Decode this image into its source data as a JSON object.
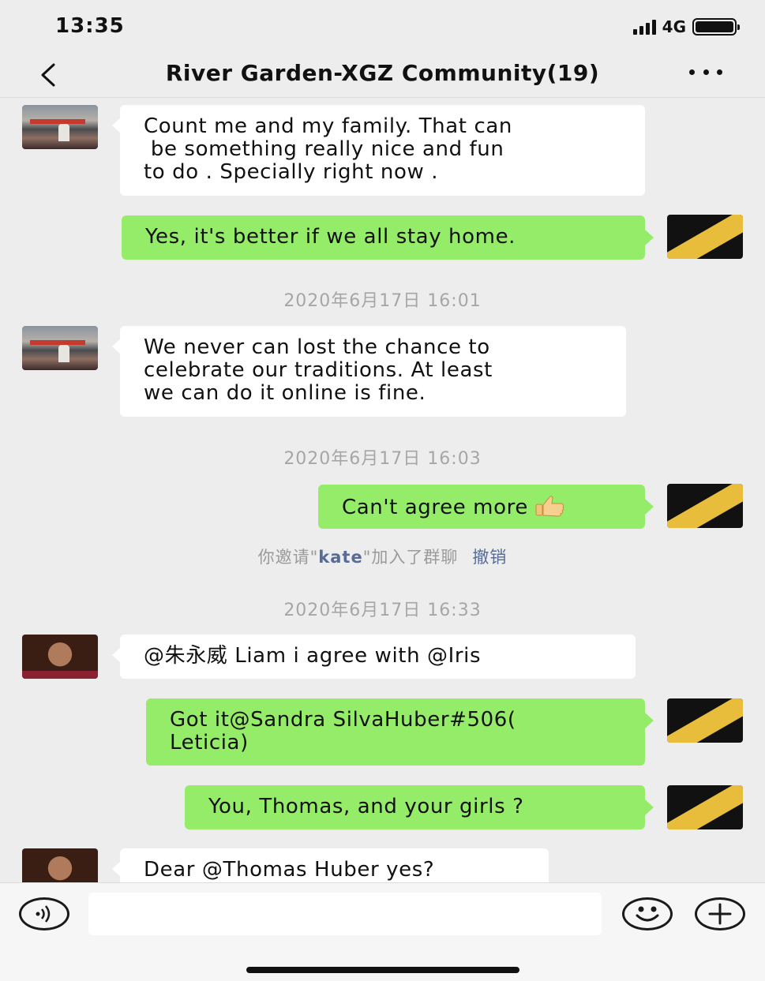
{
  "status_bar": {
    "time": "13:35",
    "network": "4G"
  },
  "nav": {
    "title": "River Garden-XGZ Community(19)",
    "back_icon": "chevron-left-icon",
    "more_icon": "more-dots-icon"
  },
  "messages": [
    {
      "side": "in",
      "avatar": "boat-photo-avatar",
      "text": [
        "Count me and my family. That can",
        " be something really nice and fun",
        "to do . Specially right now ."
      ]
    },
    {
      "side": "out",
      "avatar": "black-yellow-avatar",
      "text": [
        "Yes, it's better if we all stay home."
      ]
    },
    {
      "side": "in",
      "avatar": "boat-photo-avatar",
      "text": [
        "We never can lost the chance to",
        "celebrate our traditions. At least",
        "we can do it online is fine."
      ]
    },
    {
      "side": "out",
      "avatar": "black-yellow-avatar",
      "text": [
        "Can't agree more"
      ],
      "emoji": "thumbs-up-icon"
    },
    {
      "side": "in",
      "avatar": "woman-photo-avatar",
      "text": [
        "@朱永威 Liam  i agree  with @Iris"
      ]
    },
    {
      "side": "out",
      "avatar": "black-yellow-avatar",
      "text": [
        "Got it@Sandra SilvaHuber#506(",
        "Leticia)"
      ]
    },
    {
      "side": "out",
      "avatar": "black-yellow-avatar",
      "text": [
        "You, Thomas, and your girls ?"
      ]
    },
    {
      "side": "in",
      "avatar": "woman-photo-avatar",
      "text": [
        "Dear @Thomas Huber yes?"
      ]
    }
  ],
  "timestamps": [
    "2020年6月17日 16:01",
    "2020年6月17日 16:03",
    "2020年6月17日 16:33"
  ],
  "system_message": {
    "prefix": "你邀请\"",
    "name": "kate",
    "suffix": "\"加入了群聊",
    "action": "撤销"
  },
  "input_bar": {
    "value": "",
    "voice_icon": "voice-icon",
    "emoji_icon": "smiley-icon",
    "plus_icon": "plus-icon"
  },
  "colors": {
    "background": "#ededed",
    "outgoing_bubble": "#95ec69",
    "incoming_bubble": "#ffffff",
    "link": "#576b95",
    "timestamp": "#a6a6a6"
  }
}
